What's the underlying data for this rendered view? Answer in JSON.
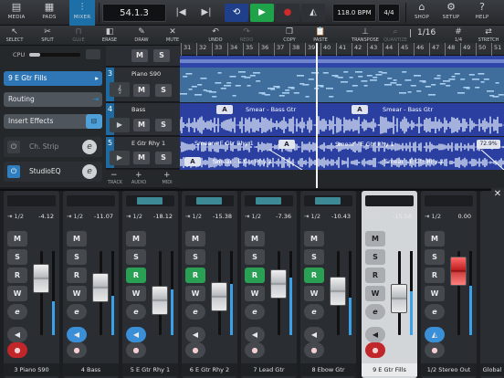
{
  "topbar": {
    "media_label": "MEDIA",
    "pads_label": "PADS",
    "mixer_label": "MIXER",
    "position": "54.1.3",
    "tempo": "118.0 BPM",
    "signature": "4/4",
    "shop_label": "SHOP",
    "setup_label": "SETUP",
    "help_label": "HELP"
  },
  "toolbar": {
    "select": "SELECT",
    "split": "SPLIT",
    "glue": "GLUE",
    "erase": "ERASE",
    "draw": "DRAW",
    "mute": "MUTE",
    "undo": "UNDO",
    "redo": "REDO",
    "copy": "COPY",
    "paste": "PASTE",
    "transpose": "TRANSPOSE",
    "quantize": "QUANTIZE",
    "quantize_value": "1/16",
    "grid_value": "1/4",
    "stretch": "STRETCH"
  },
  "inspector": {
    "cpu_label": "CPU",
    "track_name": "9  E Gtr Fills",
    "routing_label": "Routing",
    "insert_effects_label": "Insert Effects",
    "ch_strip_label": "Ch. Strip",
    "studioeq_label": "StudioEQ"
  },
  "ruler": {
    "marks": [
      "31",
      "32",
      "33",
      "34",
      "35",
      "36",
      "37",
      "38",
      "39",
      "40",
      "41",
      "42",
      "43",
      "44",
      "45",
      "46",
      "47",
      "48",
      "49",
      "50",
      "51"
    ]
  },
  "tracks": [
    {
      "number": "3",
      "name": "Piano S90"
    },
    {
      "number": "4",
      "name": "Bass",
      "events": [
        "Smear - Bass Gtr",
        "Smear - Bass Gtr"
      ]
    },
    {
      "number": "5",
      "name": "E Gtr Rhy 1",
      "events": [
        "Smear - E Gtr Rhy 1",
        "Smear - E Gtr Rhy 1",
        "Smear - E Gtr Rhy 2",
        "Smear - E Gtr Rhy 2"
      ],
      "fade_label": "72.9%"
    }
  ],
  "track_footer": {
    "track": "TRACK",
    "audio": "AUDIO",
    "midi": "MIDI"
  },
  "mixer": {
    "strips": [
      {
        "name": "3  Piano S90",
        "routing": "1/2",
        "volume": "-4.12"
      },
      {
        "name": "4  Bass",
        "routing": "1/2",
        "volume": "-11.07"
      },
      {
        "name": "5  E Gtr Rhy 1",
        "routing": "1/2",
        "volume": "-18.12"
      },
      {
        "name": "6  E Gtr Rhy 2",
        "routing": "1/2",
        "volume": "-15.38"
      },
      {
        "name": "7  Lead Gtr",
        "routing": "1/2",
        "volume": "-7.36"
      },
      {
        "name": "8  Ebow Gtr",
        "routing": "1/2",
        "volume": "-10.43"
      },
      {
        "name": "9  E Gtr Fills",
        "routing": "1/2",
        "volume": "-15.58"
      },
      {
        "name": "1/2 Stereo Out",
        "routing": "1/2",
        "volume": "0.00"
      },
      {
        "name": "Global"
      }
    ]
  },
  "colors": {
    "accent": "#1d6fa8",
    "play_green": "#1fa34a",
    "record_red": "#d12a2a",
    "wave_blue": "#2a3fa0",
    "piano_blue": "#4a7fb0",
    "read_green": "#2aa055"
  }
}
